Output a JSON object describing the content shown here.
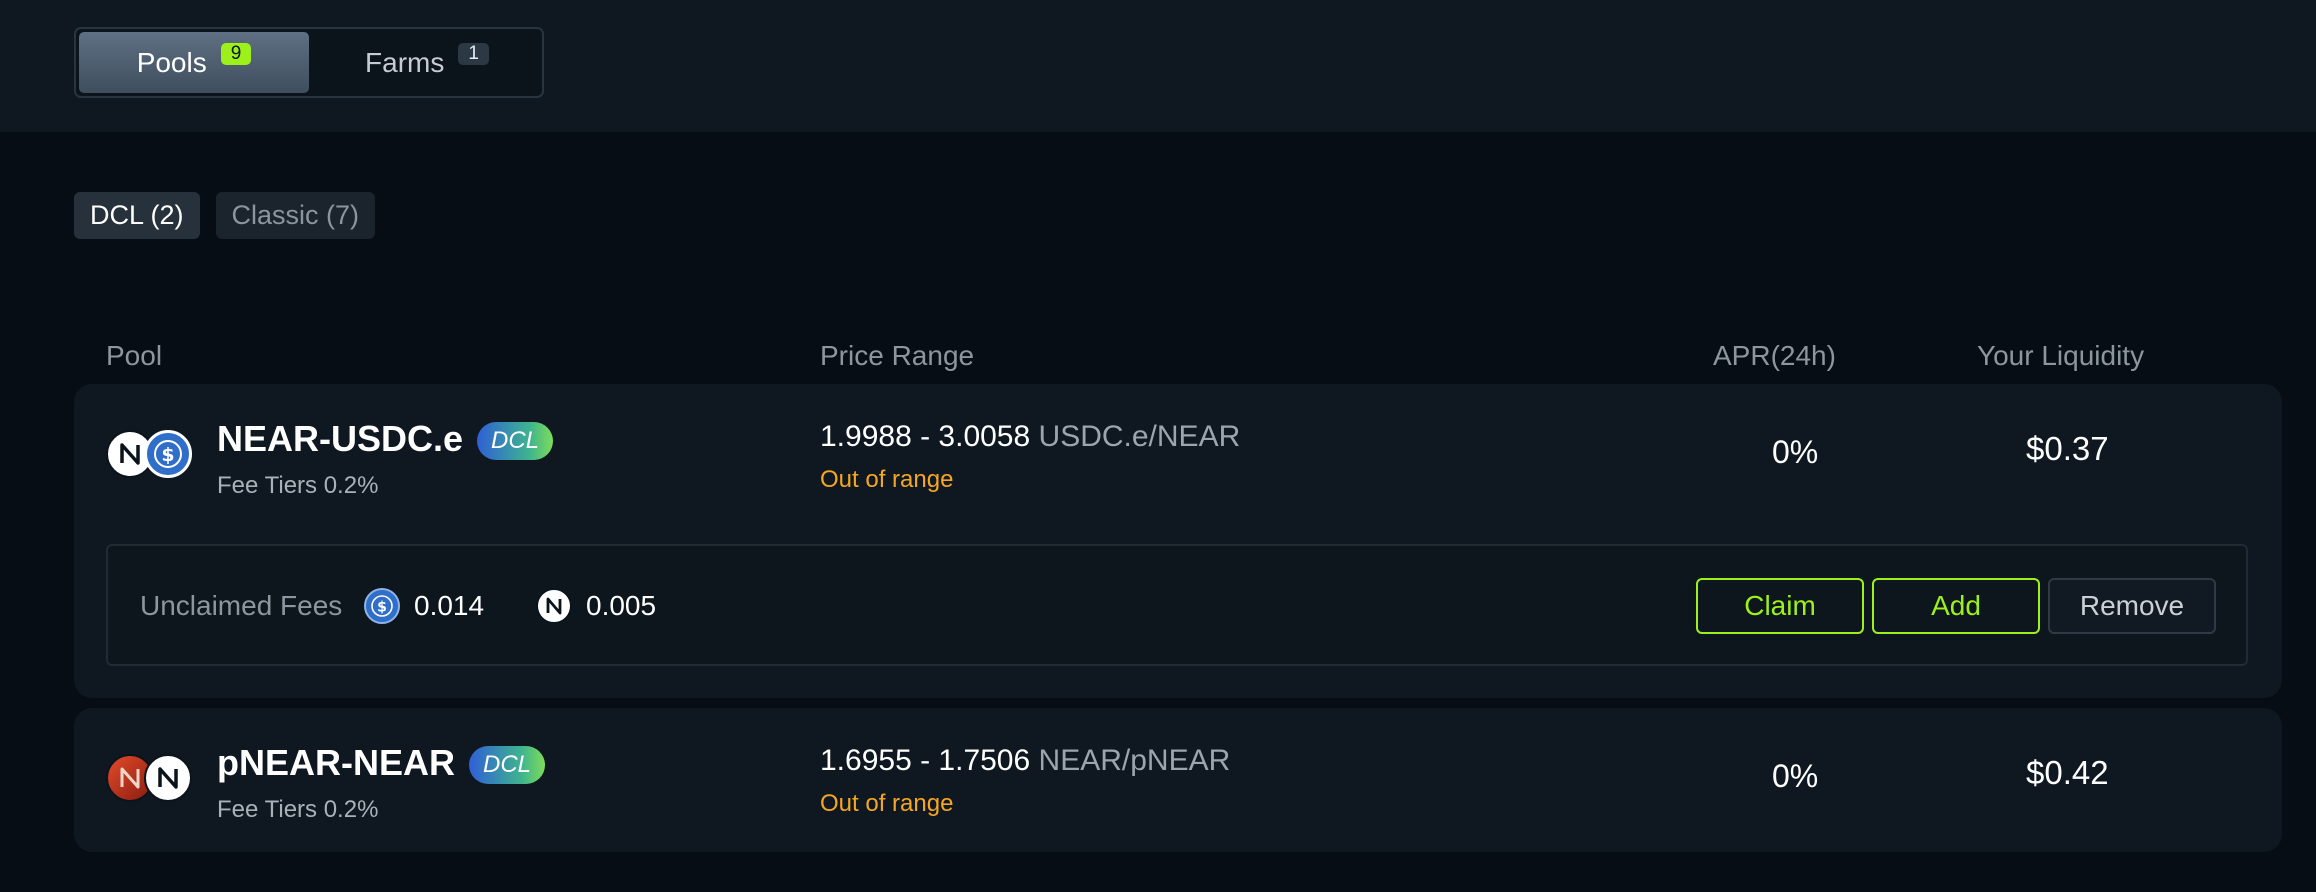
{
  "tabs": {
    "pools": {
      "label": "Pools",
      "count": "9"
    },
    "farms": {
      "label": "Farms",
      "count": "1"
    }
  },
  "filters": {
    "dcl": "DCL (2)",
    "classic": "Classic (7)"
  },
  "columns": {
    "pool": "Pool",
    "price_range": "Price Range",
    "apr": "APR(24h)",
    "liquidity": "Your Liquidity"
  },
  "pools": [
    {
      "name": "NEAR-USDC.e",
      "badge": "DCL",
      "fee": "Fee Tiers 0.2%",
      "range": "1.9988 - 3.0058",
      "unit": "USDC.e/NEAR",
      "status": "Out of range",
      "apr": "0%",
      "liquidity": "$0.37",
      "tokens": [
        "near-icon",
        "usdc-icon"
      ],
      "unclaimed": {
        "label": "Unclaimed Fees",
        "amounts": [
          {
            "token": "usdc-icon",
            "value": "0.014"
          },
          {
            "token": "near-icon",
            "value": "0.005"
          }
        ],
        "actions": {
          "claim": "Claim",
          "add": "Add",
          "remove": "Remove"
        }
      }
    },
    {
      "name": "pNEAR-NEAR",
      "badge": "DCL",
      "fee": "Fee Tiers 0.2%",
      "range": "1.6955 - 1.7506",
      "unit": "NEAR/pNEAR",
      "status": "Out of range",
      "apr": "0%",
      "liquidity": "$0.42",
      "tokens": [
        "pnear-icon",
        "near-icon"
      ]
    }
  ],
  "colors": {
    "accent_green": "#9ef01a",
    "warning_orange": "#f5a623",
    "background": "#060d14",
    "card": "#0f1820"
  }
}
